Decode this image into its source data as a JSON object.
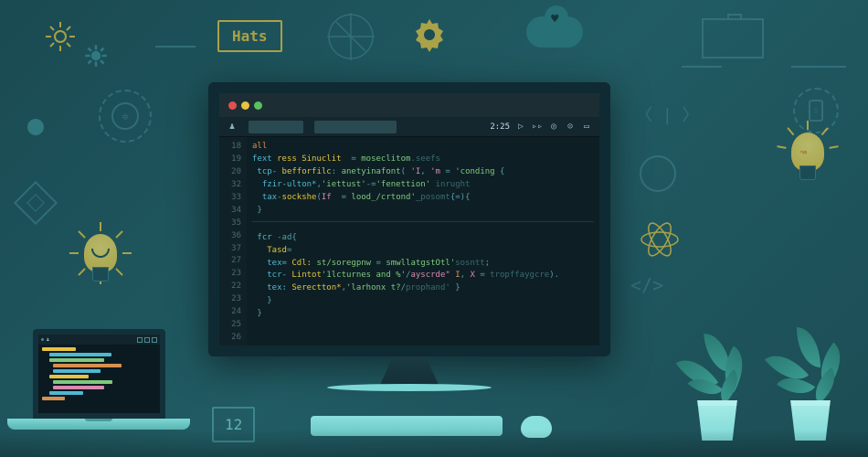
{
  "badge_label": "Hats",
  "box_number": "12",
  "monitor": {
    "time": "2:25",
    "lines": [
      "18",
      "19",
      "20",
      "32",
      "33",
      "34",
      "35",
      "36",
      "37",
      "27",
      "23",
      "22",
      "23",
      "24",
      "25",
      "26"
    ],
    "code": [
      {
        "cls": "kw",
        "t": "all"
      },
      {
        "cls": "",
        "t": " fext ress Sinuclit  = moseclitom.seefs"
      },
      {
        "cls": "",
        "t": " tcp- befforfilc: anetyinafont( 'I, 'm = 'conding {"
      },
      {
        "cls": "",
        "t": "  fzir-ulton*,'iettust'-='fenettion' inrught"
      },
      {
        "cls": "",
        "t": "  tax-sockshe(If  = lood_/crtond'_posomt{=){"
      },
      {
        "cls": "",
        "t": " }"
      },
      {
        "cls": "kw",
        "t": " fcr -ad{"
      },
      {
        "cls": "",
        "t": "   Tasd="
      },
      {
        "cls": "",
        "t": "   tex= Cdl: st/soregpnw = smwllatgstOtl'sosntt;"
      },
      {
        "cls": "",
        "t": "   tcr- Lintot'1lcturnes and %'/ayscrde\" I, X = tropffaygcre)."
      },
      {
        "cls": "",
        "t": "   tex: Serectton*,'larhonx t?/prophand' }"
      },
      {
        "cls": "",
        "t": "   }"
      },
      {
        "cls": "",
        "t": " }"
      }
    ]
  }
}
